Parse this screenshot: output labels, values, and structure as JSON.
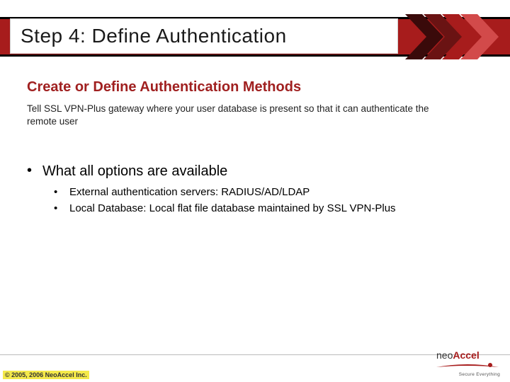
{
  "title": "Step 4: Define Authentication",
  "subtitle": "Create or Define Authentication Methods",
  "description": "Tell SSL VPN-Plus gateway where your user database is present so that it can authenticate the remote user",
  "bullets": {
    "main": "What all options are available",
    "sub": [
      "External authentication servers: RADIUS/AD/LDAP",
      "Local Database: Local flat file database maintained by SSL VPN-Plus"
    ]
  },
  "footer": {
    "copyright": "© 2005, 2006 NeoAccel Inc.",
    "logo_part1": "neo",
    "logo_part2": "Accel",
    "logo_tag": "Secure Everything"
  }
}
